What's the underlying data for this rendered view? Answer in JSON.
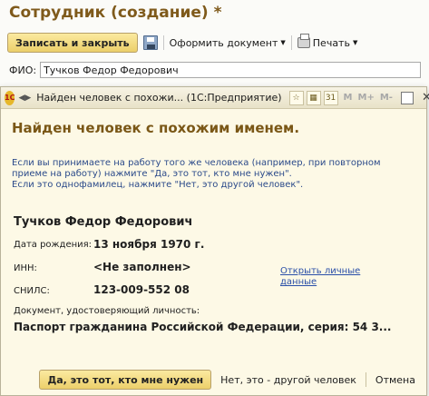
{
  "background_form": {
    "title": "Сотрудник (создание) *",
    "toolbar": {
      "save_close_label": "Записать и закрыть",
      "save_icon": "floppy-disk-icon",
      "form_doc_label": "Оформить документ",
      "print_label": "Печать",
      "print_icon": "printer-icon"
    },
    "fio_label": "ФИО:",
    "fio_value": "Тучков Федор Федорович"
  },
  "dialog": {
    "title": "Найден человек с похожи... (1С:Предприятие)",
    "logo_text": "1С",
    "toolbar": {
      "m_label": "M",
      "m_plus_label": "M+",
      "m_minus_label": "M-",
      "calendar_day": "31"
    },
    "heading": "Найден человек с похожим именем.",
    "info_line1": "Если вы принимаете на работу того же человека (например, при повторном приеме на работу) нажмите \"Да, это тот, кто мне нужен\".",
    "info_line2": "Если это однофамилец, нажмите \"Нет, это другой человек\".",
    "person": {
      "name": "Тучков Федор Федорович",
      "birth_label": "Дата рождения:",
      "birth_value": "13 ноября 1970 г.",
      "inn_label": "ИНН:",
      "inn_value": "<Не заполнен>",
      "snils_label": "СНИЛС:",
      "snils_value": "123-009-552 08",
      "open_link": "Открыть личные данные",
      "doc_label": "Документ, удостоверяющий личность:",
      "doc_value": "Паспорт гражданина Российской Федерации, серия: 54 3..."
    },
    "footer": {
      "yes_label": "Да, это тот, кто мне нужен",
      "no_label": "Нет, это - другой человек",
      "cancel_label": "Отмена"
    }
  },
  "colors": {
    "title_brown": "#7f5a1b",
    "info_blue": "#2b4a8a",
    "link_blue": "#2a4fa8",
    "dialog_bg": "#fdf9e6",
    "button_yellow": "#eccf6a"
  }
}
